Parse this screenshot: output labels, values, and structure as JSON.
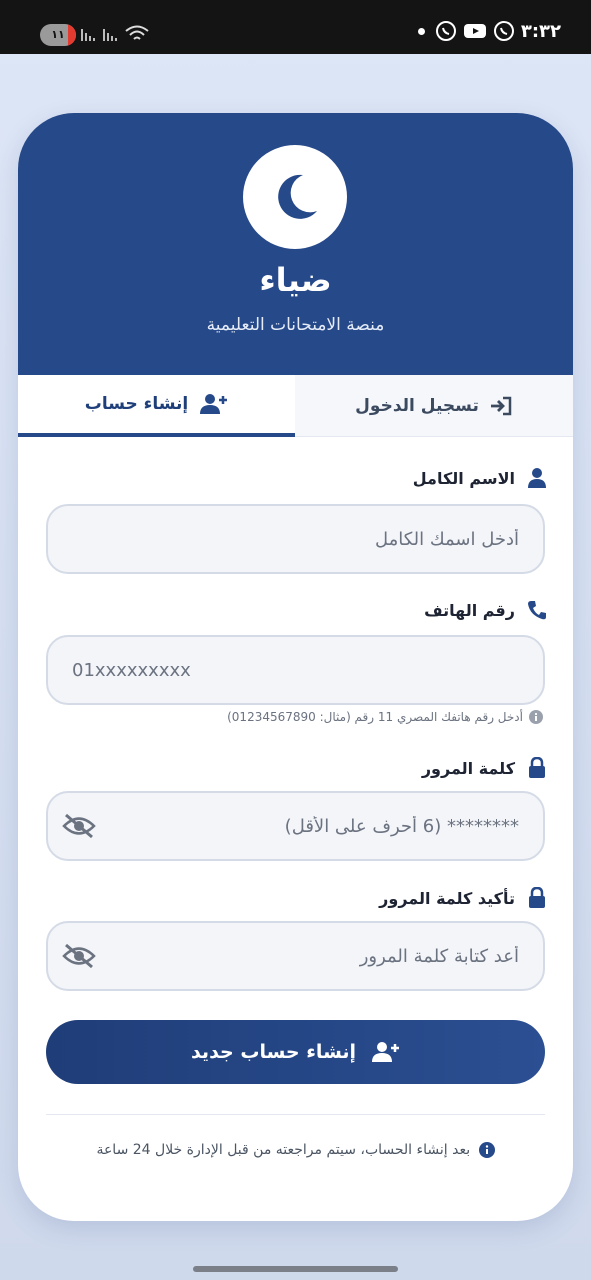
{
  "status_bar": {
    "time": "٣:٣٢",
    "battery": "١١"
  },
  "app": {
    "title": "ضياء",
    "subtitle": "منصة الامتحانات التعليمية"
  },
  "tabs": [
    {
      "label": "إنشاء حساب",
      "active": true
    },
    {
      "label": "تسجيل الدخول",
      "active": false
    }
  ],
  "form": {
    "full_name": {
      "label": "الاسم الكامل",
      "placeholder": "أدخل اسمك الكامل"
    },
    "phone": {
      "label": "رقم الهاتف",
      "placeholder": "01xxxxxxxxx",
      "hint": "أدخل رقم هاتفك المصري 11 رقم (مثال: 01234567890)"
    },
    "password": {
      "label": "كلمة المرور",
      "placeholder": "******** (6 أحرف على الأقل)"
    },
    "confirm_password": {
      "label": "تأكيد كلمة المرور",
      "placeholder": "أعد كتابة كلمة المرور"
    },
    "submit_label": "إنشاء حساب جديد"
  },
  "footer_note": "بعد إنشاء الحساب، سيتم مراجعته من قبل الإدارة خلال 24 ساعة",
  "colors": {
    "primary": "#26498a",
    "background": "#dde6f6",
    "status_bar": "#141414"
  }
}
